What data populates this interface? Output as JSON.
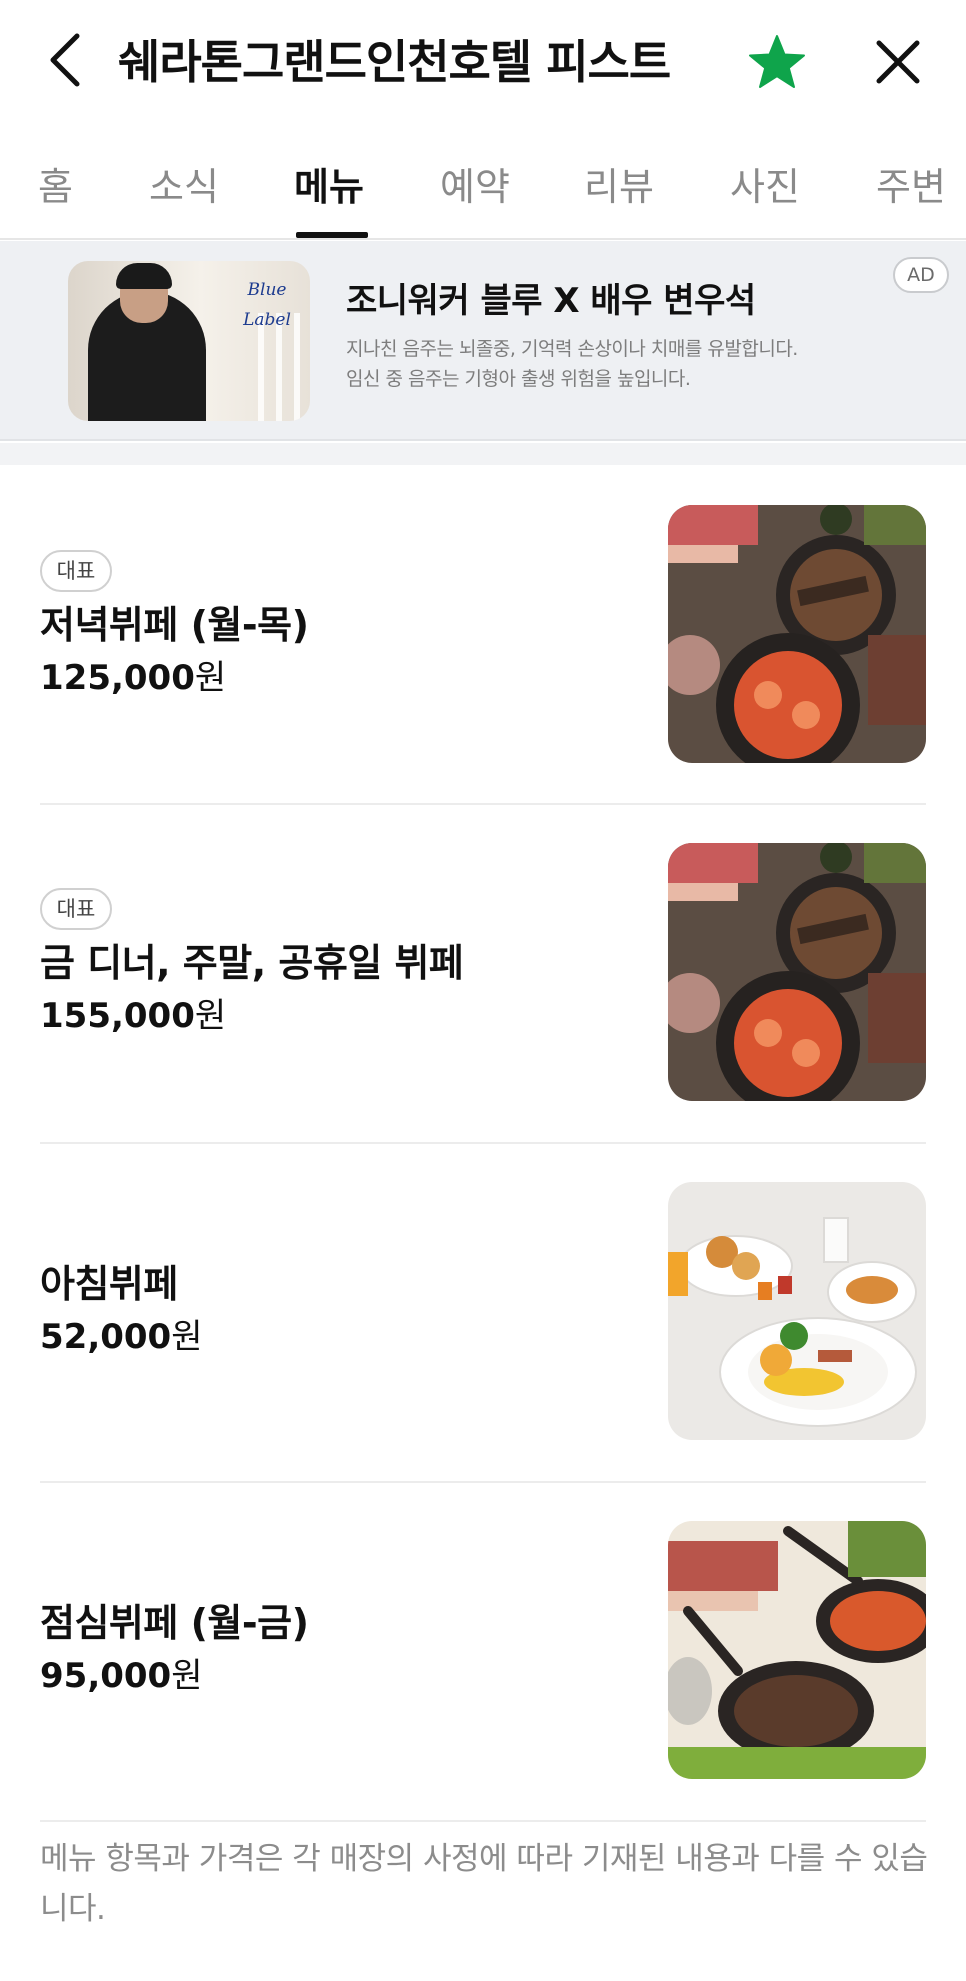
{
  "header": {
    "title": "쉐라톤그랜드인천호텔 피스트",
    "back_icon": "chevron-left-icon",
    "favorite_icon": "star-icon",
    "favorite_color": "#0fa44b",
    "close_icon": "close-icon"
  },
  "tabs": [
    {
      "label": "홈",
      "active": false
    },
    {
      "label": "소식",
      "active": false
    },
    {
      "label": "메뉴",
      "active": true
    },
    {
      "label": "예약",
      "active": false
    },
    {
      "label": "리뷰",
      "active": false
    },
    {
      "label": "사진",
      "active": false
    },
    {
      "label": "주변",
      "active": false
    }
  ],
  "ad": {
    "brand_mark": "Blue Label",
    "title": "조니워커 블루 X 배우 변우석",
    "line1": "지나친 음주는 뇌졸중, 기억력 손상이나 치매를 유발합니다.",
    "line2": "임신 중 음주는 기형아 출생 위험을 높입니다.",
    "badge": "AD"
  },
  "menu": {
    "currency": "원",
    "items": [
      {
        "badge": "대표",
        "name": "저녁뷔페 (월-목)",
        "price": "125,000",
        "image": "dinner-buffet-photo"
      },
      {
        "badge": "대표",
        "name": "금 디너, 주말, 공휴일 뷔페",
        "price": "155,000",
        "image": "weekend-buffet-photo"
      },
      {
        "badge": "",
        "name": "아침뷔페",
        "price": "52,000",
        "image": "breakfast-buffet-photo"
      },
      {
        "badge": "",
        "name": "점심뷔페 (월-금)",
        "price": "95,000",
        "image": "lunch-buffet-photo"
      }
    ],
    "footnote": "메뉴 항목과 가격은 각 매장의 사정에 따라 기재된 내용과 다를 수 있습니다."
  }
}
